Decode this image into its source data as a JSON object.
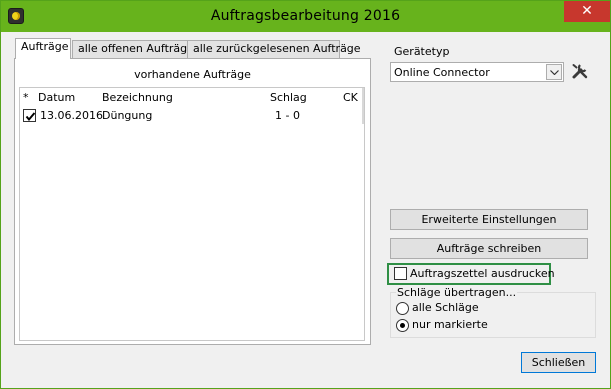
{
  "window": {
    "title": "Auftragsbearbeitung 2016",
    "close_glyph": "✕",
    "accent_color": "#67b31c",
    "app_icon": "app-icon"
  },
  "tabs": [
    {
      "label": "Aufträge",
      "active": true
    },
    {
      "label": "alle offenen Aufträge",
      "active": false
    },
    {
      "label": "alle zurückgelesenen Aufträge",
      "active": false
    }
  ],
  "orders": {
    "caption": "vorhandene Aufträge",
    "columns": {
      "marker": "*",
      "date": "Datum",
      "name": "Bezeichnung",
      "schlag": "Schlag",
      "ck": "CK"
    },
    "rows": [
      {
        "checked": true,
        "date": "13.06.2016",
        "name": "Düngung",
        "schlag": "1 - 0",
        "ck": ""
      }
    ]
  },
  "device": {
    "label": "Gerätetyp",
    "selected": "Online Connector",
    "settings_icon": "tools-icon"
  },
  "buttons": {
    "advanced": "Erweiterte Einstellungen",
    "write": "Aufträge schreiben",
    "close": "Schließen"
  },
  "print_option": {
    "label": "Auftragszettel ausdrucken",
    "checked": false,
    "highlight_color": "#2f8f45"
  },
  "transfer": {
    "title": "Schläge übertragen...",
    "options": [
      {
        "label": "alle Schläge",
        "checked": false
      },
      {
        "label": "nur markierte",
        "checked": true
      }
    ]
  }
}
